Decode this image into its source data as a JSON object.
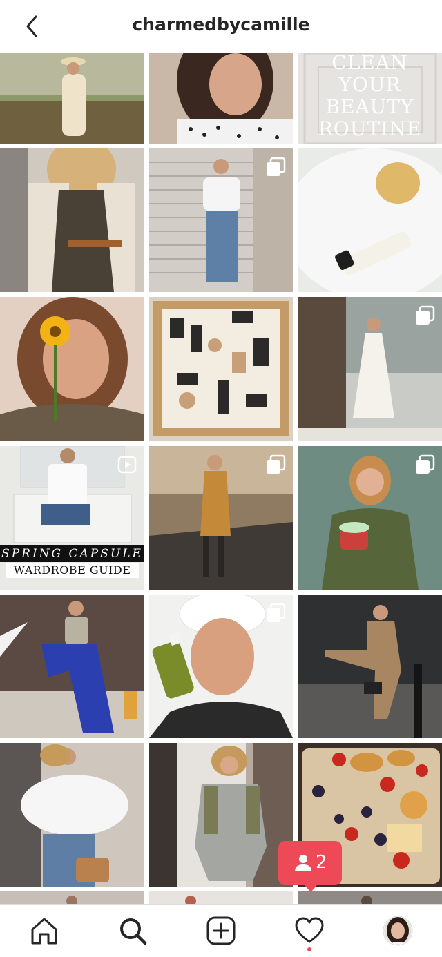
{
  "header": {
    "title": "charmedbycamille",
    "back_icon": "chevron-left-icon"
  },
  "grid": {
    "posts": [
      {
        "id": "post-1",
        "overlay_text": ""
      },
      {
        "id": "post-2",
        "overlay_text": ""
      },
      {
        "id": "post-3",
        "overlay_text": "CLEAN YOUR BEAUTY ROUTINE"
      },
      {
        "id": "post-4",
        "overlay_text": ""
      },
      {
        "id": "post-5",
        "overlay_text": "",
        "badge": "multi-photo-icon"
      },
      {
        "id": "post-6",
        "overlay_text": ""
      },
      {
        "id": "post-7",
        "overlay_text": ""
      },
      {
        "id": "post-8",
        "overlay_text": ""
      },
      {
        "id": "post-9",
        "overlay_text": "",
        "badge": "multi-photo-icon"
      },
      {
        "id": "post-10",
        "overlay_text": "SPRING CAPSULE",
        "overlay_text_2": "WARDROBE GUIDE",
        "badge": "video-icon"
      },
      {
        "id": "post-11",
        "overlay_text": "",
        "badge": "multi-photo-icon"
      },
      {
        "id": "post-12",
        "overlay_text": "",
        "badge": "multi-photo-icon"
      },
      {
        "id": "post-13",
        "overlay_text": ""
      },
      {
        "id": "post-14",
        "overlay_text": "",
        "badge": "multi-photo-icon"
      },
      {
        "id": "post-15",
        "overlay_text": ""
      },
      {
        "id": "post-16",
        "overlay_text": ""
      },
      {
        "id": "post-17",
        "overlay_text": ""
      },
      {
        "id": "post-18",
        "overlay_text": ""
      }
    ]
  },
  "notification": {
    "count": "2",
    "icon": "person-icon",
    "color": "#ed4956"
  },
  "tabbar": {
    "items": [
      {
        "name": "home",
        "icon": "home-icon"
      },
      {
        "name": "search",
        "icon": "search-icon",
        "active": true
      },
      {
        "name": "new-post",
        "icon": "plus-square-icon"
      },
      {
        "name": "activity",
        "icon": "heart-icon"
      },
      {
        "name": "profile",
        "icon": "avatar-icon"
      }
    ]
  },
  "colors": {
    "accent": "#ed4956",
    "text": "#262626",
    "divider": "#dbdbdb"
  }
}
